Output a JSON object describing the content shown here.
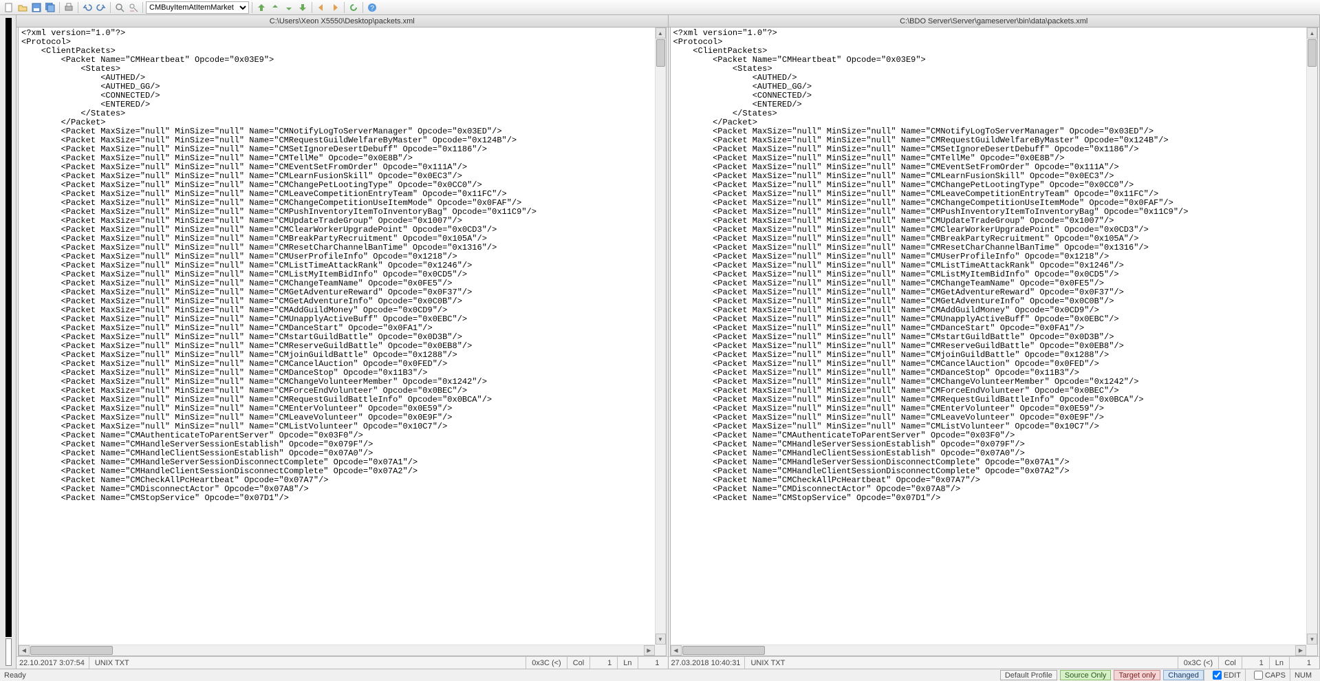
{
  "toolbar": {
    "dropdown_value": "CMBuyItemAtItemMarket"
  },
  "left": {
    "title": "C:\\Users\\Xeon X5550\\Desktop\\packets.xml",
    "lines": [
      "<?xml version=\"1.0\"?>",
      "<Protocol>",
      "    <ClientPackets>",
      "        <Packet Name=\"CMHeartbeat\" Opcode=\"0x03E9\">",
      "            <States>",
      "                <AUTHED/>",
      "                <AUTHED_GG/>",
      "                <CONNECTED/>",
      "                <ENTERED/>",
      "            </States>",
      "        </Packet>",
      "        <Packet MaxSize=\"null\" MinSize=\"null\" Name=\"CMNotifyLogToServerManager\" Opcode=\"0x03ED\"/>",
      "        <Packet MaxSize=\"null\" MinSize=\"null\" Name=\"CMRequestGuildWelfareByMaster\" Opcode=\"0x124B\"/>",
      "        <Packet MaxSize=\"null\" MinSize=\"null\" Name=\"CMSetIgnoreDesertDebuff\" Opcode=\"0x1186\"/>",
      "        <Packet MaxSize=\"null\" MinSize=\"null\" Name=\"CMTellMe\" Opcode=\"0x0E8B\"/>",
      "        <Packet MaxSize=\"null\" MinSize=\"null\" Name=\"CMEventSetFromOrder\" Opcode=\"0x111A\"/>",
      "        <Packet MaxSize=\"null\" MinSize=\"null\" Name=\"CMLearnFusionSkill\" Opcode=\"0x0EC3\"/>",
      "        <Packet MaxSize=\"null\" MinSize=\"null\" Name=\"CMChangePetLootingType\" Opcode=\"0x0CC0\"/>",
      "        <Packet MaxSize=\"null\" MinSize=\"null\" Name=\"CMLeaveCompetitionEntryTeam\" Opcode=\"0x11FC\"/>",
      "        <Packet MaxSize=\"null\" MinSize=\"null\" Name=\"CMChangeCompetitionUseItemMode\" Opcode=\"0x0FAF\"/>",
      "        <Packet MaxSize=\"null\" MinSize=\"null\" Name=\"CMPushInventoryItemToInventoryBag\" Opcode=\"0x11C9\"/>",
      "        <Packet MaxSize=\"null\" MinSize=\"null\" Name=\"CMUpdateTradeGroup\" Opcode=\"0x1007\"/>",
      "        <Packet MaxSize=\"null\" MinSize=\"null\" Name=\"CMClearWorkerUpgradePoint\" Opcode=\"0x0CD3\"/>",
      "        <Packet MaxSize=\"null\" MinSize=\"null\" Name=\"CMBreakPartyRecruitment\" Opcode=\"0x105A\"/>",
      "        <Packet MaxSize=\"null\" MinSize=\"null\" Name=\"CMResetCharChannelBanTime\" Opcode=\"0x1316\"/>",
      "        <Packet MaxSize=\"null\" MinSize=\"null\" Name=\"CMUserProfileInfo\" Opcode=\"0x1218\"/>",
      "        <Packet MaxSize=\"null\" MinSize=\"null\" Name=\"CMListTimeAttackRank\" Opcode=\"0x1246\"/>",
      "        <Packet MaxSize=\"null\" MinSize=\"null\" Name=\"CMListMyItemBidInfo\" Opcode=\"0x0CD5\"/>",
      "        <Packet MaxSize=\"null\" MinSize=\"null\" Name=\"CMChangeTeamName\" Opcode=\"0x0FE5\"/>",
      "        <Packet MaxSize=\"null\" MinSize=\"null\" Name=\"CMGetAdventureReward\" Opcode=\"0x0F37\"/>",
      "        <Packet MaxSize=\"null\" MinSize=\"null\" Name=\"CMGetAdventureInfo\" Opcode=\"0x0C0B\"/>",
      "        <Packet MaxSize=\"null\" MinSize=\"null\" Name=\"CMAddGuildMoney\" Opcode=\"0x0CD9\"/>",
      "        <Packet MaxSize=\"null\" MinSize=\"null\" Name=\"CMUnapplyActiveBuff\" Opcode=\"0x0EBC\"/>",
      "        <Packet MaxSize=\"null\" MinSize=\"null\" Name=\"CMDanceStart\" Opcode=\"0x0FA1\"/>",
      "        <Packet MaxSize=\"null\" MinSize=\"null\" Name=\"CMstartGuildBattle\" Opcode=\"0x0D3B\"/>",
      "        <Packet MaxSize=\"null\" MinSize=\"null\" Name=\"CMReserveGuildBattle\" Opcode=\"0x0EB8\"/>",
      "        <Packet MaxSize=\"null\" MinSize=\"null\" Name=\"CMjoinGuildBattle\" Opcode=\"0x1288\"/>",
      "        <Packet MaxSize=\"null\" MinSize=\"null\" Name=\"CMCancelAuction\" Opcode=\"0x0FED\"/>",
      "        <Packet MaxSize=\"null\" MinSize=\"null\" Name=\"CMDanceStop\" Opcode=\"0x11B3\"/>",
      "        <Packet MaxSize=\"null\" MinSize=\"null\" Name=\"CMChangeVolunteerMember\" Opcode=\"0x1242\"/>",
      "        <Packet MaxSize=\"null\" MinSize=\"null\" Name=\"CMForceEndVolunteer\" Opcode=\"0x0BEC\"/>",
      "        <Packet MaxSize=\"null\" MinSize=\"null\" Name=\"CMRequestGuildBattleInfo\" Opcode=\"0x0BCA\"/>",
      "        <Packet MaxSize=\"null\" MinSize=\"null\" Name=\"CMEnterVolunteer\" Opcode=\"0x0E59\"/>",
      "        <Packet MaxSize=\"null\" MinSize=\"null\" Name=\"CMLeaveVolunteer\" Opcode=\"0x0E9F\"/>",
      "        <Packet MaxSize=\"null\" MinSize=\"null\" Name=\"CMListVolunteer\" Opcode=\"0x10C7\"/>",
      "        <Packet Name=\"CMAuthenticateToParentServer\" Opcode=\"0x03F0\"/>",
      "        <Packet Name=\"CMHandleServerSessionEstablish\" Opcode=\"0x079F\"/>",
      "        <Packet Name=\"CMHandleClientSessionEstablish\" Opcode=\"0x07A0\"/>",
      "        <Packet Name=\"CMHandleServerSessionDisconnectComplete\" Opcode=\"0x07A1\"/>",
      "        <Packet Name=\"CMHandleClientSessionDisconnectComplete\" Opcode=\"0x07A2\"/>",
      "        <Packet Name=\"CMCheckAllPcHeartbeat\" Opcode=\"0x07A7\"/>",
      "        <Packet Name=\"CMDisconnectActor\" Opcode=\"0x07A8\"/>",
      "        <Packet Name=\"CMStopService\" Opcode=\"0x07D1\"/>"
    ],
    "status": {
      "datetime": "22.10.2017  3:07:54",
      "encoding": "UNIX TXT",
      "char": "0x3C (<)",
      "col_label": "Col",
      "col": "1",
      "ln_label": "Ln",
      "ln": "1"
    }
  },
  "right": {
    "title": "C:\\BDO Server\\Server\\gameserver\\bin\\data\\packets.xml",
    "lines": [
      "<?xml version=\"1.0\"?>",
      "<Protocol>",
      "    <ClientPackets>",
      "        <Packet Name=\"CMHeartbeat\" Opcode=\"0x03E9\">",
      "            <States>",
      "                <AUTHED/>",
      "                <AUTHED_GG/>",
      "                <CONNECTED/>",
      "                <ENTERED/>",
      "            </States>",
      "        </Packet>",
      "        <Packet MaxSize=\"null\" MinSize=\"null\" Name=\"CMNotifyLogToServerManager\" Opcode=\"0x03ED\"/>",
      "        <Packet MaxSize=\"null\" MinSize=\"null\" Name=\"CMRequestGuildWelfareByMaster\" Opcode=\"0x124B\"/>",
      "        <Packet MaxSize=\"null\" MinSize=\"null\" Name=\"CMSetIgnoreDesertDebuff\" Opcode=\"0x1186\"/>",
      "        <Packet MaxSize=\"null\" MinSize=\"null\" Name=\"CMTellMe\" Opcode=\"0x0E8B\"/>",
      "        <Packet MaxSize=\"null\" MinSize=\"null\" Name=\"CMEventSetFromOrder\" Opcode=\"0x111A\"/>",
      "        <Packet MaxSize=\"null\" MinSize=\"null\" Name=\"CMLearnFusionSkill\" Opcode=\"0x0EC3\"/>",
      "        <Packet MaxSize=\"null\" MinSize=\"null\" Name=\"CMChangePetLootingType\" Opcode=\"0x0CC0\"/>",
      "        <Packet MaxSize=\"null\" MinSize=\"null\" Name=\"CMLeaveCompetitionEntryTeam\" Opcode=\"0x11FC\"/>",
      "        <Packet MaxSize=\"null\" MinSize=\"null\" Name=\"CMChangeCompetitionUseItemMode\" Opcode=\"0x0FAF\"/>",
      "        <Packet MaxSize=\"null\" MinSize=\"null\" Name=\"CMPushInventoryItemToInventoryBag\" Opcode=\"0x11C9\"/>",
      "        <Packet MaxSize=\"null\" MinSize=\"null\" Name=\"CMUpdateTradeGroup\" Opcode=\"0x1007\"/>",
      "        <Packet MaxSize=\"null\" MinSize=\"null\" Name=\"CMClearWorkerUpgradePoint\" Opcode=\"0x0CD3\"/>",
      "        <Packet MaxSize=\"null\" MinSize=\"null\" Name=\"CMBreakPartyRecruitment\" Opcode=\"0x105A\"/>",
      "        <Packet MaxSize=\"null\" MinSize=\"null\" Name=\"CMResetCharChannelBanTime\" Opcode=\"0x1316\"/>",
      "        <Packet MaxSize=\"null\" MinSize=\"null\" Name=\"CMUserProfileInfo\" Opcode=\"0x1218\"/>",
      "        <Packet MaxSize=\"null\" MinSize=\"null\" Name=\"CMListTimeAttackRank\" Opcode=\"0x1246\"/>",
      "        <Packet MaxSize=\"null\" MinSize=\"null\" Name=\"CMListMyItemBidInfo\" Opcode=\"0x0CD5\"/>",
      "        <Packet MaxSize=\"null\" MinSize=\"null\" Name=\"CMChangeTeamName\" Opcode=\"0x0FE5\"/>",
      "        <Packet MaxSize=\"null\" MinSize=\"null\" Name=\"CMGetAdventureReward\" Opcode=\"0x0F37\"/>",
      "        <Packet MaxSize=\"null\" MinSize=\"null\" Name=\"CMGetAdventureInfo\" Opcode=\"0x0C0B\"/>",
      "        <Packet MaxSize=\"null\" MinSize=\"null\" Name=\"CMAddGuildMoney\" Opcode=\"0x0CD9\"/>",
      "        <Packet MaxSize=\"null\" MinSize=\"null\" Name=\"CMUnapplyActiveBuff\" Opcode=\"0x0EBC\"/>",
      "        <Packet MaxSize=\"null\" MinSize=\"null\" Name=\"CMDanceStart\" Opcode=\"0x0FA1\"/>",
      "        <Packet MaxSize=\"null\" MinSize=\"null\" Name=\"CMstartGuildBattle\" Opcode=\"0x0D3B\"/>",
      "        <Packet MaxSize=\"null\" MinSize=\"null\" Name=\"CMReserveGuildBattle\" Opcode=\"0x0EB8\"/>",
      "        <Packet MaxSize=\"null\" MinSize=\"null\" Name=\"CMjoinGuildBattle\" Opcode=\"0x1288\"/>",
      "        <Packet MaxSize=\"null\" MinSize=\"null\" Name=\"CMCancelAuction\" Opcode=\"0x0FED\"/>",
      "        <Packet MaxSize=\"null\" MinSize=\"null\" Name=\"CMDanceStop\" Opcode=\"0x11B3\"/>",
      "        <Packet MaxSize=\"null\" MinSize=\"null\" Name=\"CMChangeVolunteerMember\" Opcode=\"0x1242\"/>",
      "        <Packet MaxSize=\"null\" MinSize=\"null\" Name=\"CMForceEndVolunteer\" Opcode=\"0x0BEC\"/>",
      "        <Packet MaxSize=\"null\" MinSize=\"null\" Name=\"CMRequestGuildBattleInfo\" Opcode=\"0x0BCA\"/>",
      "        <Packet MaxSize=\"null\" MinSize=\"null\" Name=\"CMEnterVolunteer\" Opcode=\"0x0E59\"/>",
      "        <Packet MaxSize=\"null\" MinSize=\"null\" Name=\"CMLeaveVolunteer\" Opcode=\"0x0E9F\"/>",
      "        <Packet MaxSize=\"null\" MinSize=\"null\" Name=\"CMListVolunteer\" Opcode=\"0x10C7\"/>",
      "        <Packet Name=\"CMAuthenticateToParentServer\" Opcode=\"0x03F0\"/>",
      "        <Packet Name=\"CMHandleServerSessionEstablish\" Opcode=\"0x079F\"/>",
      "        <Packet Name=\"CMHandleClientSessionEstablish\" Opcode=\"0x07A0\"/>",
      "        <Packet Name=\"CMHandleServerSessionDisconnectComplete\" Opcode=\"0x07A1\"/>",
      "        <Packet Name=\"CMHandleClientSessionDisconnectComplete\" Opcode=\"0x07A2\"/>",
      "        <Packet Name=\"CMCheckAllPcHeartbeat\" Opcode=\"0x07A7\"/>",
      "        <Packet Name=\"CMDisconnectActor\" Opcode=\"0x07A8\"/>",
      "        <Packet Name=\"CMStopService\" Opcode=\"0x07D1\"/>"
    ],
    "status": {
      "datetime": "27.03.2018 10:40:31",
      "encoding": "UNIX TXT",
      "char": "0x3C (<)",
      "col_label": "Col",
      "col": "1",
      "ln_label": "Ln",
      "ln": "1"
    }
  },
  "bottom": {
    "ready": "Ready",
    "profile": "Default Profile",
    "source_only": "Source Only",
    "target_only": "Target only",
    "changed": "Changed",
    "edit": "EDIT",
    "caps": "CAPS",
    "num": "NUM"
  }
}
